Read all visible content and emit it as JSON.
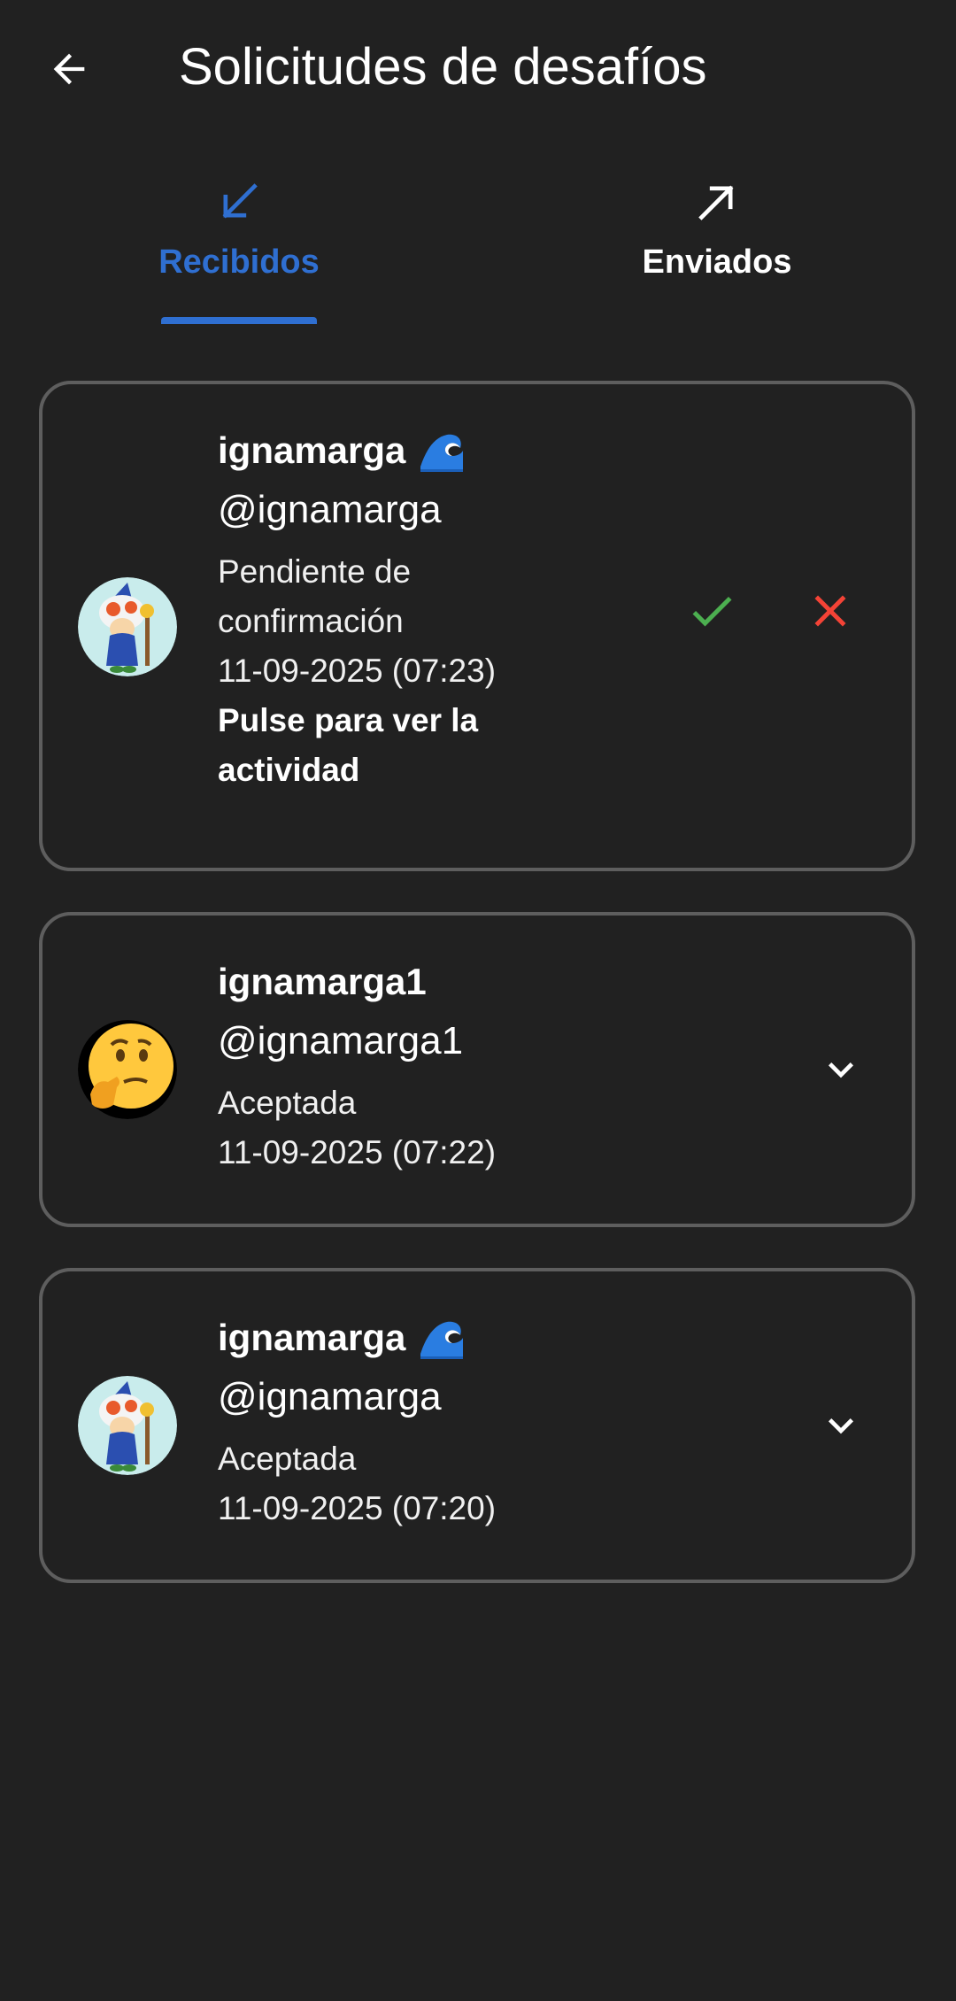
{
  "appbar": {
    "title": "Solicitudes de desafíos",
    "back_icon": "arrow-back-icon"
  },
  "tabs": [
    {
      "label": "Recibidos",
      "icon": "arrow-down-left-icon",
      "selected": true,
      "color": "#2f6fd1"
    },
    {
      "label": "Enviados",
      "icon": "arrow-up-right-icon",
      "selected": false,
      "color": "#ffffff"
    }
  ],
  "requests": [
    {
      "name": "ignamarga",
      "name_emoji": "🌊",
      "handle": "@ignamarga",
      "status": "Pendiente de confirmación",
      "date": "11-09-2025 (07:23)",
      "hint": "Pulse para ver la actividad",
      "avatar": "toad-wizard-avatar",
      "accept_color": "#4caf50",
      "reject_color": "#f44336"
    },
    {
      "name": "ignamarga1",
      "handle": "@ignamarga1",
      "status": "Aceptada",
      "date": "11-09-2025 (07:22)",
      "avatar": "thinking-face-avatar"
    },
    {
      "name": "ignamarga",
      "name_emoji": "🌊",
      "handle": "@ignamarga",
      "status": "Aceptada",
      "date": "11-09-2025 (07:20)",
      "avatar": "toad-wizard-avatar"
    }
  ]
}
